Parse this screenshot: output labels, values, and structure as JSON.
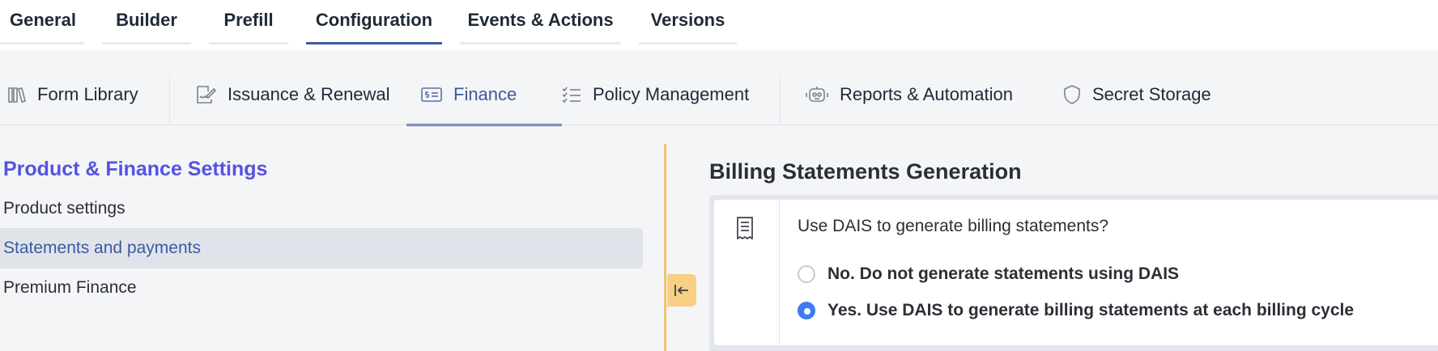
{
  "top_tabs": [
    {
      "label": "General"
    },
    {
      "label": "Builder"
    },
    {
      "label": "Prefill"
    },
    {
      "label": "Configuration",
      "active": true
    },
    {
      "label": "Events & Actions"
    },
    {
      "label": "Versions"
    }
  ],
  "subnav": [
    {
      "label": "Form Library",
      "icon": "books-icon"
    },
    {
      "label": "Issuance & Renewal",
      "icon": "signed-document-icon"
    },
    {
      "label": "Finance",
      "icon": "dollar-bill-icon",
      "active": true
    },
    {
      "label": "Policy Management",
      "icon": "checklist-icon"
    },
    {
      "label": "Reports & Automation",
      "icon": "robot-icon"
    },
    {
      "label": "Secret Storage",
      "icon": "shield-icon"
    }
  ],
  "left_panel": {
    "title": "Product & Finance Settings",
    "items": [
      {
        "label": "Product settings"
      },
      {
        "label": "Statements and payments",
        "active": true
      },
      {
        "label": "Premium Finance"
      }
    ]
  },
  "right_panel": {
    "title": "Billing Statements Generation",
    "question": "Use DAIS to generate billing statements?",
    "options": [
      {
        "label": "No. Do not generate statements using DAIS",
        "checked": false
      },
      {
        "label": "Yes. Use DAIS to generate billing statements at each billing cycle",
        "checked": true
      }
    ]
  },
  "colors": {
    "accent": "#3c5aa0",
    "section_title": "#5552e0",
    "radio_checked": "#3b7cf0",
    "splitter": "#f3c56a"
  }
}
